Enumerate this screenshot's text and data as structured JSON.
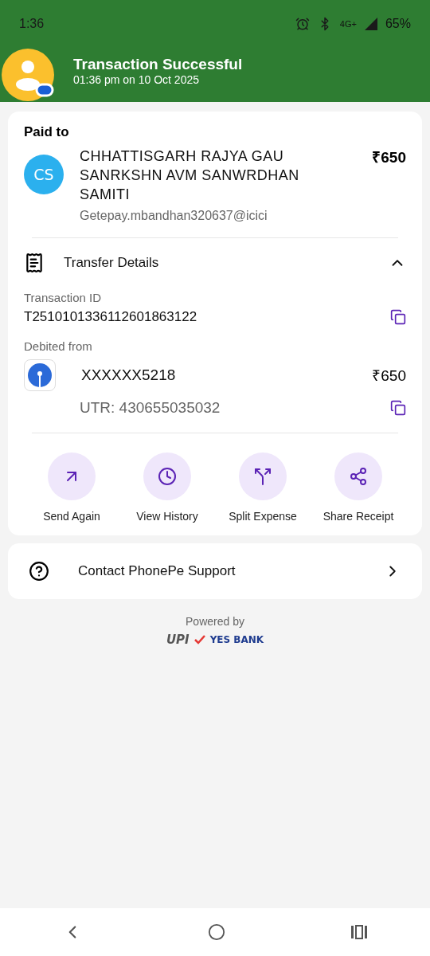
{
  "status_bar": {
    "time": "1:36",
    "network": "4G+",
    "battery": "65%"
  },
  "header": {
    "title": "Transaction Successful",
    "subtitle": "01:36 pm on 10 Oct 2025"
  },
  "paid_to": {
    "label": "Paid to",
    "initials": "CS",
    "name": "CHHATTISGARH RAJYA GAU SANRKSHN AVM SANWRDHAN SAMITI",
    "upi_id": "Getepay.mbandhan320637@icici",
    "amount": "₹650"
  },
  "transfer_details": {
    "title": "Transfer Details",
    "expanded": true,
    "transaction_id_label": "Transaction ID",
    "transaction_id": "T2510101336112601863122",
    "debited_label": "Debited from",
    "account": "XXXXXX5218",
    "amount": "₹650",
    "utr": "UTR: 430655035032"
  },
  "actions": [
    {
      "kind": "send",
      "label": "Send Again"
    },
    {
      "kind": "history",
      "label": "View History"
    },
    {
      "kind": "split",
      "label": "Split Expense"
    },
    {
      "kind": "share",
      "label": "Share Receipt"
    }
  ],
  "support": {
    "label": "Contact PhonePe Support"
  },
  "footer": {
    "powered_by": "Powered by",
    "upi": "UPI",
    "bank": "YES BANK"
  }
}
